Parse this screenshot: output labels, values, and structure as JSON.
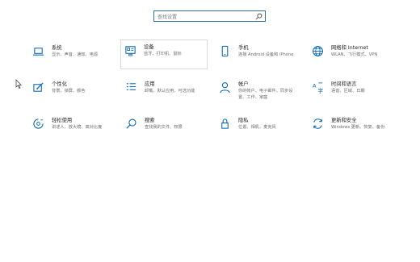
{
  "search": {
    "placeholder": "查找设置"
  },
  "tiles": [
    {
      "icon": "laptop-icon",
      "title": "系统",
      "desc": "显示、声音、通知、电源"
    },
    {
      "icon": "devices-icon",
      "title": "设备",
      "desc": "蓝牙、打印机、鼠标"
    },
    {
      "icon": "phone-icon",
      "title": "手机",
      "desc": "连接 Android 设备和 iPhone"
    },
    {
      "icon": "globe-icon",
      "title": "网络和 Internet",
      "desc": "WLAN、飞行模式、VPN"
    },
    {
      "icon": "personalization-icon",
      "title": "个性化",
      "desc": "背景、锁屏、颜色"
    },
    {
      "icon": "apps-icon",
      "title": "应用",
      "desc": "卸载、默认应用、可选功能"
    },
    {
      "icon": "person-icon",
      "title": "帐户",
      "desc": "你的帐户、电子邮件、同步设置、工作、家庭"
    },
    {
      "icon": "time-language-icon",
      "title": "时间和语言",
      "desc": "语音、区域、日期"
    },
    {
      "icon": "ease-of-access-icon",
      "title": "轻松使用",
      "desc": "讲述人、放大镜、高对比度"
    },
    {
      "icon": "search-icon",
      "title": "搜索",
      "desc": "查找我的文件、权限"
    },
    {
      "icon": "lock-icon",
      "title": "隐私",
      "desc": "位置、相机、麦克风"
    },
    {
      "icon": "update-icon",
      "title": "更新和安全",
      "desc": "Windows 更新、恢复、备份"
    }
  ],
  "accent_color": "#0063b1"
}
